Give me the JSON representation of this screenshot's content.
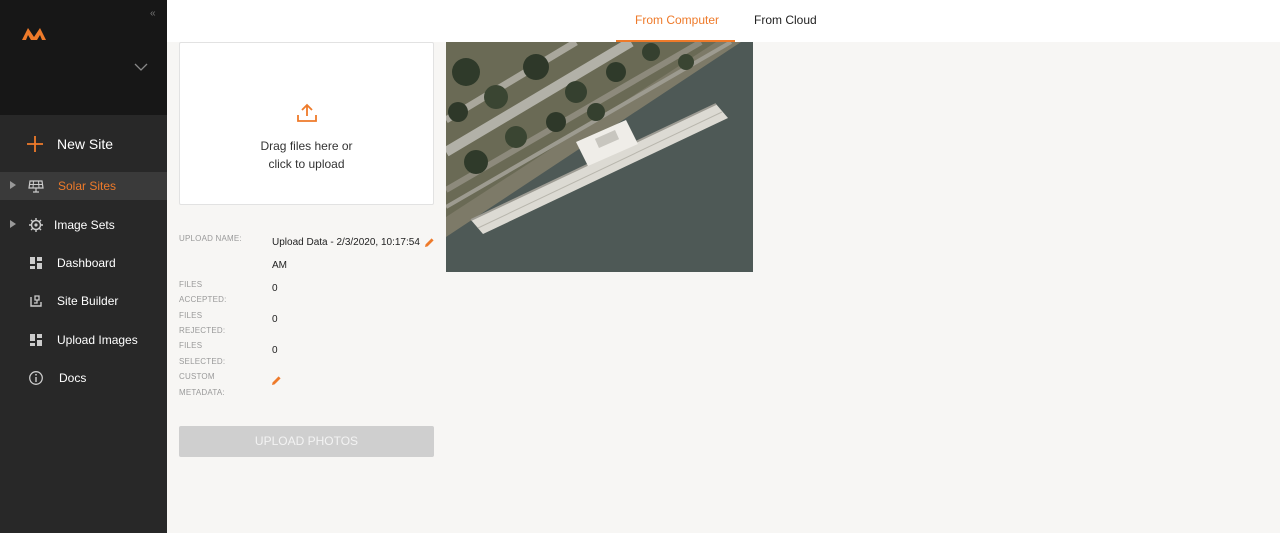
{
  "sidebar": {
    "new_site_label": "New Site",
    "items": [
      {
        "label": "Solar Sites",
        "icon": "solar-panel-icon",
        "active": true,
        "expandable": true
      },
      {
        "label": "Image Sets",
        "icon": "gear-icon",
        "active": false,
        "expandable": true
      },
      {
        "label": "Dashboard",
        "icon": "dashboard-icon",
        "active": false,
        "expandable": false
      },
      {
        "label": "Site Builder",
        "icon": "site-builder-icon",
        "active": false,
        "expandable": false
      },
      {
        "label": "Upload Images",
        "icon": "upload-images-icon",
        "active": false,
        "expandable": false
      },
      {
        "label": "Docs",
        "icon": "info-icon",
        "active": false,
        "expandable": false
      }
    ]
  },
  "tabs": [
    {
      "label": "From Computer",
      "active": true
    },
    {
      "label": "From Cloud",
      "active": false
    }
  ],
  "dropzone": {
    "line1": "Drag files here or",
    "line2": "click to upload"
  },
  "fields": {
    "upload_name_label": "UPLOAD NAME:",
    "upload_name_value_line1": "Upload Data - 2/3/2020, 10:17:54",
    "upload_name_value_line2": "AM",
    "files_accepted_label_1": "FILES",
    "files_accepted_label_2": "ACCEPTED:",
    "files_accepted_value": "0",
    "files_rejected_label_1": "FILES",
    "files_rejected_label_2": "REJECTED:",
    "files_rejected_value": "0",
    "files_selected_label_1": "FILES",
    "files_selected_label_2": "SELECTED:",
    "files_selected_value": "0",
    "custom_metadata_label_1": "CUSTOM",
    "custom_metadata_label_2": "METADATA:"
  },
  "upload_button_label": "UPLOAD PHOTOS",
  "colors": {
    "accent": "#ee7a2a",
    "sidebar_bg": "#282828",
    "sidebar_top_bg": "#171717",
    "page_bg": "#f7f6f4",
    "button_disabled": "#cfcfcf"
  }
}
